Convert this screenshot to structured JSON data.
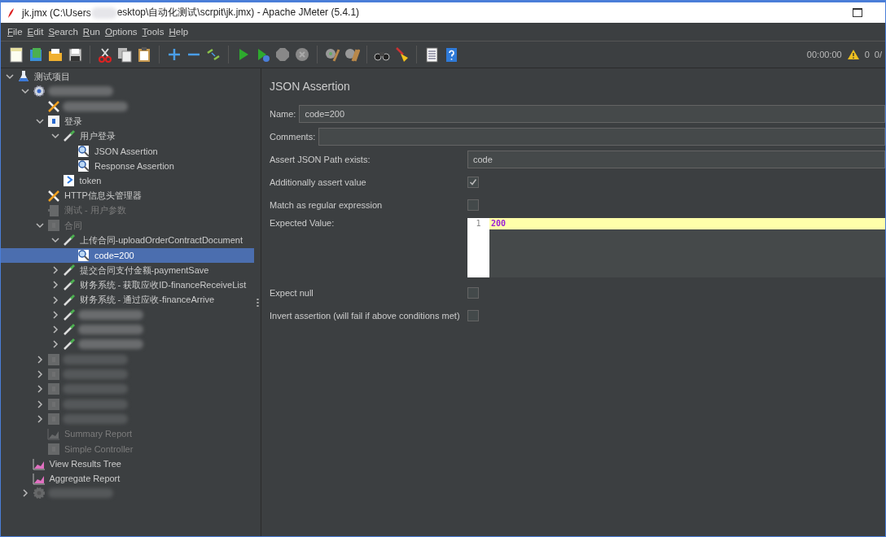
{
  "window": {
    "title_before_blur": "jk.jmx (C:\\Users",
    "title_after_blur": "esktop\\自动化测试\\scrpit\\jk.jmx) - Apache JMeter (5.4.1)"
  },
  "menu": [
    "File",
    "Edit",
    "Search",
    "Run",
    "Options",
    "Tools",
    "Help"
  ],
  "status": {
    "timer": "00:00:00",
    "warnings": "0",
    "threads": "0/"
  },
  "tree": [
    {
      "label": "测试项目",
      "kind": "plan",
      "expanded": true,
      "selected": false,
      "disabled": false,
      "children": [
        {
          "kind": "gear",
          "expanded": true,
          "selected": false,
          "disabled": false,
          "children": [
            {
              "kind": "wrench",
              "selected": false,
              "disabled": false
            },
            {
              "label": "登录",
              "kind": "controller",
              "expanded": true,
              "selected": false,
              "disabled": false,
              "children": [
                {
                  "label": "用户登录",
                  "kind": "sampler",
                  "expanded": true,
                  "selected": false,
                  "disabled": false,
                  "children": [
                    {
                      "label": "JSON Assertion",
                      "kind": "assertion",
                      "selected": false,
                      "disabled": false
                    },
                    {
                      "label": "Response Assertion",
                      "kind": "assertion",
                      "selected": false,
                      "disabled": false
                    }
                  ]
                },
                {
                  "label": "token",
                  "kind": "extractor",
                  "selected": false,
                  "disabled": false
                }
              ]
            },
            {
              "label": "HTTP信息头管理器",
              "kind": "wrench",
              "selected": false,
              "disabled": false
            },
            {
              "label": "测试 - 用户参数",
              "kind": "preprocessor",
              "selected": false,
              "disabled": true
            },
            {
              "label": "合同",
              "kind": "controller",
              "expanded": true,
              "selected": false,
              "disabled": true,
              "children": [
                {
                  "label": "上传合同-uploadOrderContractDocument",
                  "kind": "sampler",
                  "expanded": true,
                  "selected": false,
                  "disabled": false,
                  "children": [
                    {
                      "label": "code=200",
                      "kind": "assertion",
                      "selected": true,
                      "disabled": false
                    }
                  ]
                },
                {
                  "label": "提交合同支付金额-paymentSave",
                  "kind": "sampler",
                  "expanded": false,
                  "selected": false,
                  "disabled": false
                },
                {
                  "label": "财务系统 - 获取应收ID-financeReceiveList",
                  "kind": "sampler",
                  "expanded": false,
                  "selected": false,
                  "disabled": false
                },
                {
                  "label": "财务系统 - 通过应收-financeArrive",
                  "kind": "sampler",
                  "expanded": false,
                  "selected": false,
                  "disabled": false
                },
                {
                  "kind": "sampler",
                  "expanded": false,
                  "selected": false,
                  "disabled": false
                },
                {
                  "kind": "sampler",
                  "expanded": false,
                  "selected": false,
                  "disabled": false
                },
                {
                  "kind": "sampler",
                  "expanded": false,
                  "selected": false,
                  "disabled": false
                }
              ]
            },
            {
              "kind": "controller",
              "expanded": false,
              "selected": false,
              "disabled": true
            },
            {
              "kind": "controller",
              "expanded": false,
              "selected": false,
              "disabled": true
            },
            {
              "kind": "controller",
              "expanded": false,
              "selected": false,
              "disabled": true
            },
            {
              "kind": "controller",
              "expanded": false,
              "selected": false,
              "disabled": true
            },
            {
              "kind": "controller",
              "expanded": false,
              "selected": false,
              "disabled": true
            },
            {
              "label": "Summary Report",
              "kind": "report",
              "selected": false,
              "disabled": true
            },
            {
              "label": "Simple Controller",
              "kind": "controller",
              "selected": false,
              "disabled": true
            }
          ]
        },
        {
          "label": "View Results Tree",
          "kind": "report",
          "selected": false,
          "disabled": false
        },
        {
          "label": "Aggregate Report",
          "kind": "report",
          "selected": false,
          "disabled": false
        },
        {
          "kind": "gear",
          "expanded": false,
          "selected": false,
          "disabled": true
        }
      ]
    }
  ],
  "panel": {
    "title": "JSON Assertion",
    "rows": [
      {
        "kind": "inline_text",
        "label": "Name:",
        "value": "code=200"
      },
      {
        "kind": "inline_text",
        "label": "Comments:"
      },
      {
        "kind": "text",
        "label": "Assert JSON Path exists:",
        "value": "code"
      },
      {
        "kind": "checkbox",
        "label": "Additionally assert value",
        "checked": true
      },
      {
        "kind": "checkbox",
        "label": "Match as regular expression",
        "checked": false
      },
      {
        "kind": "editor",
        "label": "Expected Value:",
        "line_number": "1",
        "value": "200"
      },
      {
        "kind": "checkbox",
        "label": "Expect null",
        "checked": false
      },
      {
        "kind": "checkbox",
        "label": "Invert assertion (will fail if above conditions met)",
        "checked": false
      }
    ]
  }
}
